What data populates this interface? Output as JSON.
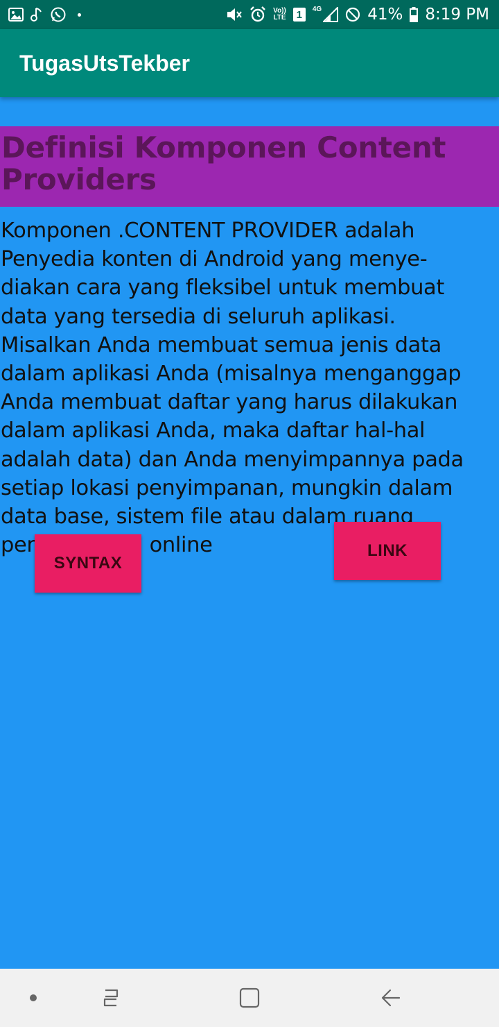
{
  "status_bar": {
    "battery": "41%",
    "time": "8:19 PM",
    "volte_top": "Vo))",
    "volte_bottom": "LTE",
    "sim": "1",
    "network": "4G",
    "left_icons": [
      "gallery-icon",
      "music-note-icon",
      "whatsapp-icon",
      "notification-dot"
    ],
    "right_icons": [
      "mute-icon",
      "alarm-icon",
      "volte-icon",
      "sim-icon",
      "signal-icon",
      "dnd-icon",
      "battery-icon"
    ]
  },
  "app_bar": {
    "title": "TugasUtsTekber"
  },
  "content": {
    "heading": "Definisi Komponen Content Providers",
    "paragraph_lines": [
      "Komponen .CONTENT PROVIDER adalah",
      "Penyedia konten di Android yang menye-",
      "diakan cara yang fleksibel untuk membuat",
      "data yang tersedia di seluruh aplikasi.",
      "Misalkan Anda membuat semua jenis data",
      "dalam aplikasi Anda (misalnya menganggap",
      "Anda membuat daftar yang harus dilakukan",
      "dalam aplikasi Anda, maka daftar hal-hal",
      "adalah data) dan Anda menyimpannya pada",
      "setiap lokasi penyimpanan, mungkin dalam",
      "data base, sistem file atau dalam ruang",
      "penyimpanan online"
    ]
  },
  "buttons": {
    "syntax": "SYNTAX",
    "link": "LINK"
  },
  "colors": {
    "status_bar": "#00695C",
    "app_bar": "#00897B",
    "background": "#2196F3",
    "heading_bg": "#9C27B0",
    "heading_text": "#5B1659",
    "button": "#E91E63",
    "nav_bar": "#F1F1F1"
  },
  "nav_bar": {
    "icons": [
      "dot-icon",
      "recent-apps-icon",
      "home-icon",
      "back-icon"
    ]
  }
}
